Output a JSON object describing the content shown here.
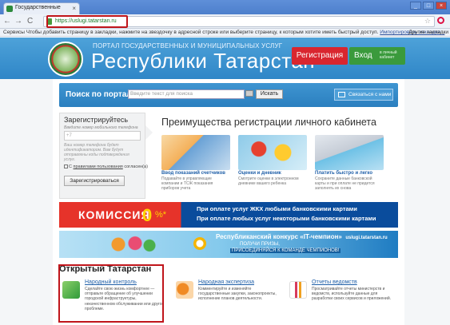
{
  "browser": {
    "tab_title": "Государственные",
    "tab_close": "×",
    "url": "https://uslugi.tatarstan.ru",
    "back": "←",
    "forward": "→",
    "reload": "C",
    "star": "☆",
    "win_min": "_",
    "win_max": "□",
    "win_close": "×",
    "bookmarks_prefix": "Сервисы  Чтобы добавить страницу в закладки, нажмите на звездочку в адресной строке или выберите страницу, к которым хотите иметь быстрый доступ.",
    "bookmarks_link": "Импортировать закладки...",
    "bookmarks_other": "Другие закладки"
  },
  "header": {
    "subtitle": "ПОРТАЛ ГОСУДАРСТВЕННЫХ И МУНИЦИПАЛЬНЫХ УСЛУГ",
    "title": "Республики Татарстан",
    "register_label": "Регистрация",
    "login_label": "Вход",
    "login_sub": "в личный кабинет"
  },
  "search": {
    "label": "Поиск по порталу:",
    "placeholder": "Введите текст для поиска",
    "button": "Искать",
    "contact": "Связаться с нами"
  },
  "register": {
    "title": "Зарегистрируйтесь",
    "hint": "Введите номер мобильного телефона",
    "phone_placeholder": "+7",
    "desc": "Ваш номер телефона будет идентификатором. Вам будут отправлены коды подтверждения услуг.",
    "agree_prefix": "С",
    "agree_link": "правилами пользования",
    "agree_suffix": "согласен(а)",
    "button": "Зарегистрироваться"
  },
  "advantages": {
    "title": "Преимущества регистрации личного кабинета",
    "cards": [
      {
        "title": "Ввод показаний счетчиков",
        "text": "Подавайте в управляющие компании и ТСЖ показания приборов учета"
      },
      {
        "title": "Оценки и дневник",
        "text": "Смотрите оценки в электронном дневнике вашего ребенка"
      },
      {
        "title": "Платить быстро и легко",
        "text": "Сохраните данные банковской карты и при оплате не придется заполнять их снова"
      }
    ]
  },
  "banner1": {
    "left": "КОМИССИЯ",
    "zero": "0",
    "pct": "%*",
    "line1": "При оплате услуг ЖКХ любыми банковскими картами",
    "line2": "При оплате любых услуг некоторыми банковскими картами"
  },
  "banner2": {
    "headline": "Республиканский конкурс «IT-чемпион»",
    "site": "uslugi.tatarstan.ru",
    "line1": "ПОЛУЧИ ПРИЗЫ,",
    "line2": "ПРИСОЕДИНЯЙСЯ К КОМАНДЕ ЧЕМПИОНОВ!"
  },
  "open_tatarstan": {
    "title": "Открытый Татарстан",
    "items": [
      {
        "title": "Народный контроль",
        "text": "Сделайте свою жизнь комфортнее — отправьте обращение об улучшении городской инфраструктуры, некачественном обслуживании или другой проблеме."
      },
      {
        "title": "Народная экспертиза",
        "text": "Комментируйте и изменяйте государственные закупки, законопроекты, исполнение планов деятельности."
      },
      {
        "title": "Отчеты ведомств",
        "text": "Просматривайте отчеты министерств и ведомств, используйте данные для разработки своих сервисов и приложений."
      }
    ]
  },
  "colors": {
    "accent_blue": "#2f86c7",
    "register_red": "#d9262f",
    "login_green": "#3a9a3c",
    "highlight_red": "#c0151b"
  }
}
